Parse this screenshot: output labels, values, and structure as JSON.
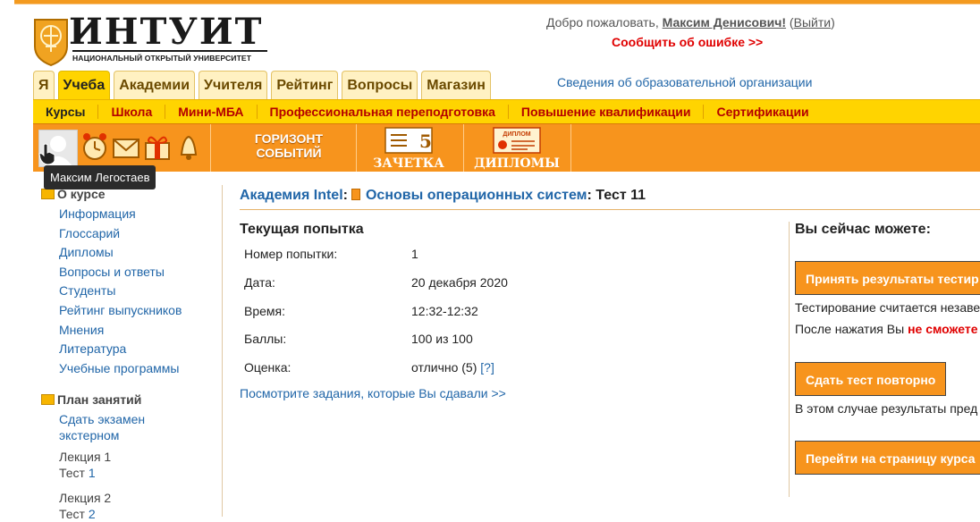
{
  "logo": {
    "title": "ИНТУИТ",
    "subtitle": "НАЦИОНАЛЬНЫЙ ОТКРЫТЫЙ УНИВЕРСИТЕТ"
  },
  "header": {
    "welcome_prefix": "Добро пожаловать,",
    "user_name": "Максим Денисович!",
    "logout": "Выйти",
    "report_error": "Сообщить об ошибке >>",
    "org_info": "Сведения об образовательной организации"
  },
  "tabs": [
    {
      "label": "Я"
    },
    {
      "label": "Учеба"
    },
    {
      "label": "Академии"
    },
    {
      "label": "Учителя"
    },
    {
      "label": "Рейтинг"
    },
    {
      "label": "Вопросы"
    },
    {
      "label": "Магазин"
    }
  ],
  "subnav": [
    {
      "label": "Курсы"
    },
    {
      "label": "Школа"
    },
    {
      "label": "Мини-МБА"
    },
    {
      "label": "Профессиональная переподготовка"
    },
    {
      "label": "Повышение квалификации"
    },
    {
      "label": "Сертификации"
    }
  ],
  "toolbar": {
    "horizont_line1": "ГОРИЗОНТ",
    "horizont_line2": "СОБЫТИЙ",
    "zachetka": "ЗАЧЕТКА",
    "zachetka_mark": "5",
    "diplomy": "ДИПЛОМЫ",
    "diploma_card": "ДИПЛОМ"
  },
  "tooltip": "Максим Легостаев",
  "sidebar": {
    "about_title": "О курсе",
    "about_links": [
      "Информация",
      "Глоссарий",
      "Дипломы",
      "Вопросы и ответы",
      "Студенты",
      "Рейтинг выпускников",
      "Мнения",
      "Литература",
      "Учебные программы"
    ],
    "plan_title": "План занятий",
    "external_exam_line1": "Сдать экзамен",
    "external_exam_line2": "экстерном",
    "lectures": [
      {
        "lecture": "Лекция 1",
        "test_prefix": "Тест",
        "test_num": "1"
      },
      {
        "lecture": "Лекция 2",
        "test_prefix": "Тест",
        "test_num": "2"
      }
    ]
  },
  "breadcrumb": {
    "academy": "Академия Intel",
    "course": "Основы операционных систем",
    "test": ": Тест 11"
  },
  "attempt": {
    "title": "Текущая попытка",
    "rows": [
      {
        "label": "Номер попытки:",
        "value": "1"
      },
      {
        "label": "Дата:",
        "value": "20 декабря 2020"
      },
      {
        "label": "Время:",
        "value": "12:32-12:32"
      },
      {
        "label": "Баллы:",
        "value": "100 из 100"
      },
      {
        "label": "Оценка:",
        "value": "отлично (5)"
      }
    ],
    "help": "[?]",
    "see_tasks": "Посмотрите задания, которые Вы сдавали >>"
  },
  "right_panel": {
    "title": "Вы сейчас можете:",
    "accept_button": "Принять результаты тестир",
    "accept_note": "Тестирование считается незаве",
    "after_press_prefix": "После нажатия Вы ",
    "after_press_warn": "не сможете",
    "retake_button": "Сдать тест повторно",
    "retake_note": "В этом случае результаты пред",
    "course_button": "Перейти на страницу курса"
  },
  "colors": {
    "accent_orange": "#f7941d",
    "tab_yellow": "#ffd400",
    "link_blue": "#2166a8",
    "error_red": "#e00000"
  }
}
